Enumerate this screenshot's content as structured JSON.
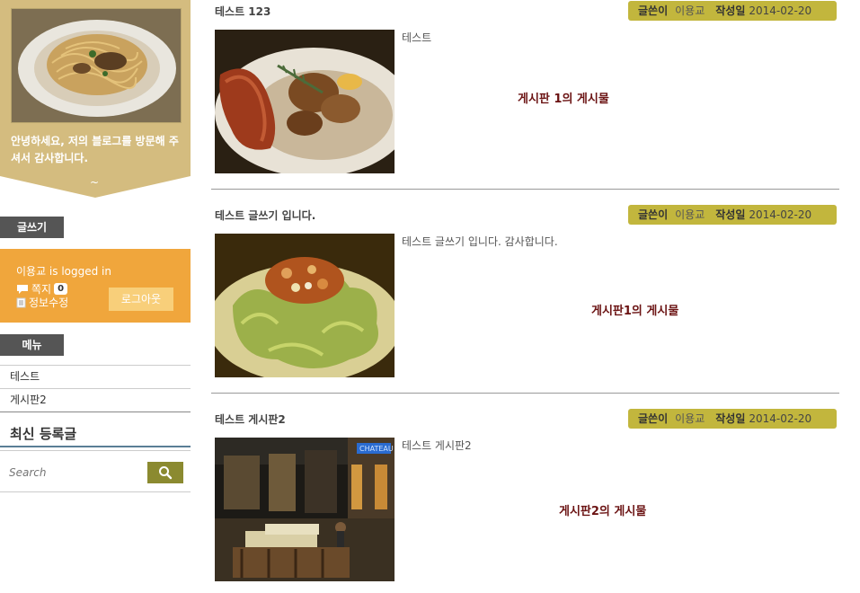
{
  "sidebar": {
    "profile_text": "안녕하세요, 저의 블로그를 방문해 주셔서 감사합니다.",
    "profile_tilde": "~",
    "write_title": "글쓰기",
    "login": {
      "status": "이용교 is logged in",
      "message_label": "쪽지",
      "message_count": "0",
      "edit_label": "정보수정",
      "logout_label": "로그아웃"
    },
    "menu_title": "메뉴",
    "menu_items": [
      "테스트",
      "게시판2"
    ],
    "recent_title": "최신 등록글",
    "search_placeholder": "Search"
  },
  "posts": [
    {
      "title": "테스트 123",
      "author_label": "글쓴이",
      "author": "이용교",
      "date_label": "작성일",
      "date": "2014-02-20",
      "excerpt": "테스트",
      "board": "게시판 1의 게시물"
    },
    {
      "title": "테스트 글쓰기 입니다.",
      "author_label": "글쓴이",
      "author": "이용교",
      "date_label": "작성일",
      "date": "2014-02-20",
      "excerpt": "테스트 글쓰기 입니다. 감사합니다.",
      "board": "게시판1의 게시물"
    },
    {
      "title": "테스트 게시판2",
      "author_label": "글쓴이",
      "author": "이용교",
      "date_label": "작성일",
      "date": "2014-02-20",
      "excerpt": "테스트 게시판2",
      "board": "게시판2의 게시물"
    }
  ],
  "colors": {
    "profile_bg": "#d4bc7f",
    "widget_title_bg": "#555555",
    "login_bg": "#f0a63c",
    "meta_bg": "#c2b63d",
    "board_text": "#6b1313",
    "search_btn": "#8b8a30"
  }
}
